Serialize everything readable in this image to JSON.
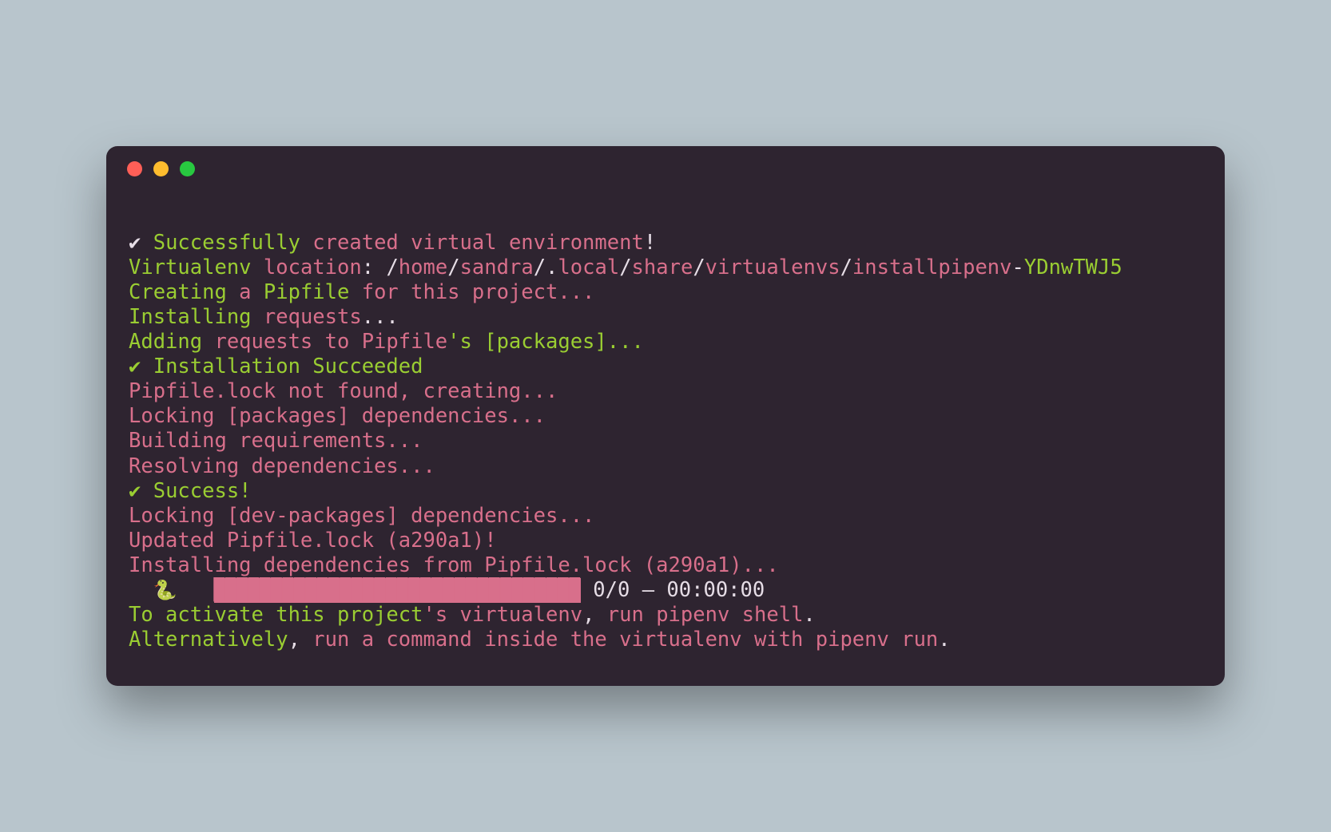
{
  "line1": {
    "check": "✔",
    "t1": " Successfully",
    "t2": " created virtual environment",
    "t3": "!"
  },
  "line2": {
    "t1": "Virtualenv ",
    "t2": "location",
    "t3": ": ",
    "t4": "/",
    "t5": "home",
    "t6": "/",
    "t7": "sandra",
    "t8": "/.",
    "t9": "local",
    "t10": "/",
    "t11": "share",
    "t12": "/",
    "t13": "virtualenvs",
    "t14": "/",
    "t15": "installpipenv",
    "t16": "-",
    "t17": "YDnwTWJ5"
  },
  "line3": {
    "t1": "Creating",
    "t2": " a ",
    "t3": "Pipfile",
    "t4": " for this project..."
  },
  "line4": {
    "t1": "Installing ",
    "t2": "requests",
    "t3": "..."
  },
  "line5": {
    "t1": "Adding ",
    "t2": "requests to Pipfile",
    "t3": "'s [packages]..."
  },
  "line6": {
    "check": "✔",
    "t1": " Installation Succeeded"
  },
  "line7": {
    "t1": "Pipfile.lock not found, creating..."
  },
  "line8": {
    "t1": "Locking ",
    "t2": "[packages]",
    "t3": " dependencies..."
  },
  "line9": {
    "t1": "Building requirements..."
  },
  "line10": {
    "t1": "Resolving dependencies..."
  },
  "line11": {
    "check": "✔",
    "t1": " Success!"
  },
  "line12": {
    "t1": "Locking ",
    "t2": "[dev-packages]",
    "t3": " dependencies..."
  },
  "line13": {
    "t1": "Updated Pipfile.lock ",
    "t2": "(a290a1)!"
  },
  "line14": {
    "t1": "Installing dependencies from Pipfile.lock ",
    "t2": "(a290a1)..."
  },
  "line15": {
    "indent": "  ",
    "snake": "🐍",
    "pad": "   ",
    "bar": "▉▉▉▉▉▉▉▉▉▉▉▉▉▉▉▉▉▉▉▉▉▉▉▉▉▉▉▉▉▉▉▉",
    "stats": " 0/0 — 00:00:00"
  },
  "line16": {
    "t1": "To activate this project",
    "t2": "'s virtualenv",
    "t3": ", ",
    "t4": "run pipenv shell",
    "t5": "."
  },
  "line17": {
    "t1": "Alternatively",
    "t2": ",",
    "t3": " run a command inside the virtualenv with pipenv run",
    "t4": "."
  }
}
